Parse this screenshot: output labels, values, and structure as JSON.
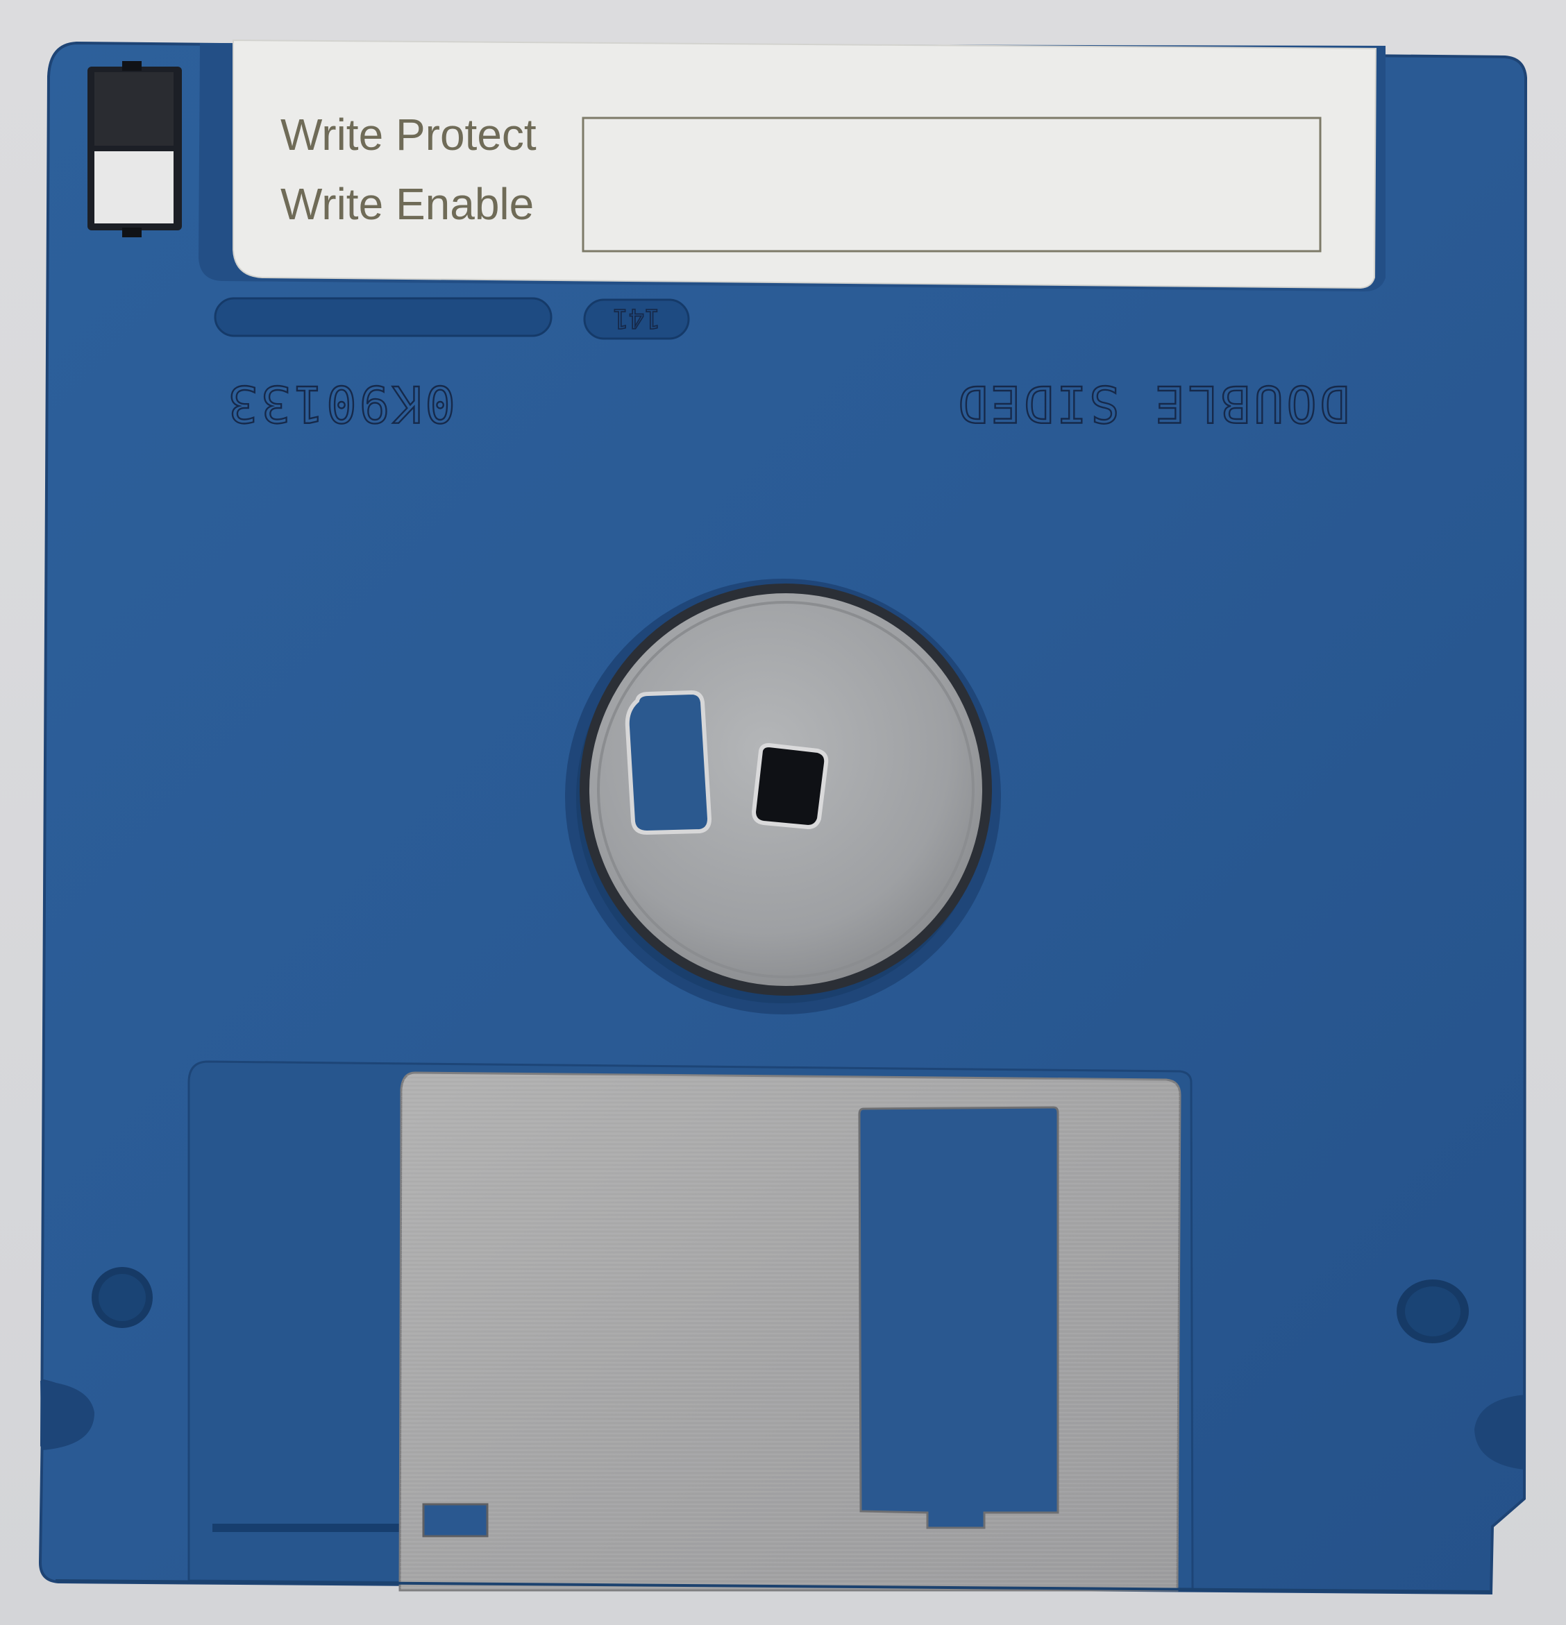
{
  "label": {
    "write_protect": "Write Protect",
    "write_enable": "Write Enable",
    "write_in_box": ""
  },
  "embossed": {
    "part_number": "0K90133",
    "side_marking": "DOUBLE SIDED",
    "mold_number": "141"
  },
  "colors": {
    "shell": "#2a5b95",
    "shell_dark": "#1d4578",
    "shutter": "#a8a8a8",
    "hub": "#a3a5a8",
    "label_paper": "#ececea",
    "label_ink": "#6f6b57"
  },
  "icons": {
    "write_protect_tab": "write-protect-slider-icon",
    "hub": "metal-hub-icon",
    "shutter": "metal-shutter-icon"
  }
}
